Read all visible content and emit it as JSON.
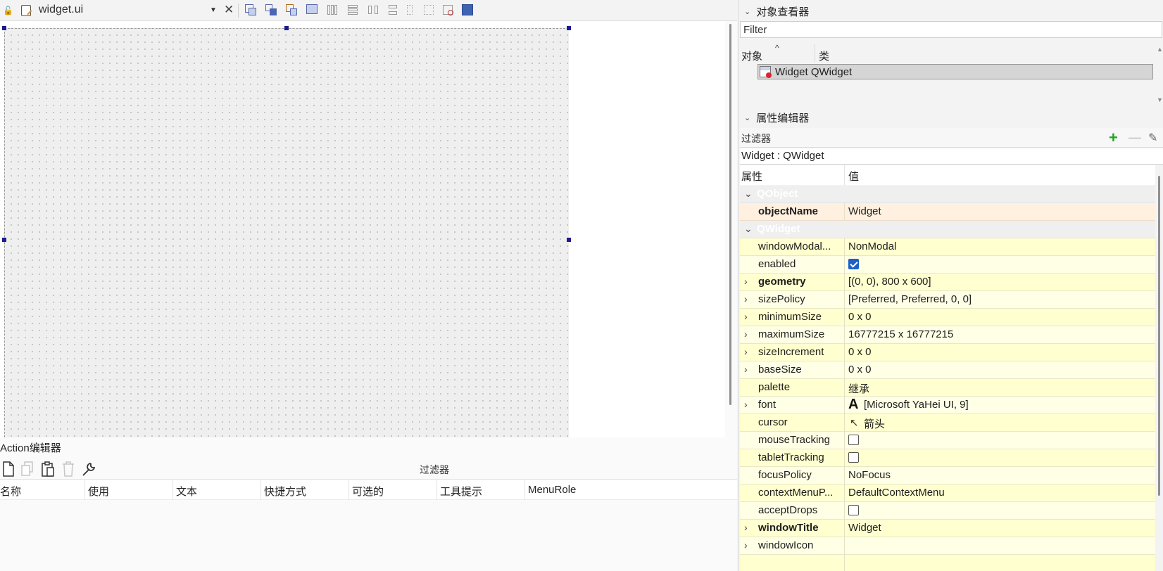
{
  "editor": {
    "filename": "widget.ui"
  },
  "action_editor": {
    "title": "Action编辑器",
    "filter_label": "过滤器",
    "columns": [
      "名称",
      "使用",
      "文本",
      "快捷方式",
      "可选的",
      "工具提示",
      "MenuRole"
    ]
  },
  "object_inspector": {
    "title": "对象查看器",
    "filter_placeholder": "Filter",
    "col_object": "对象",
    "col_class": "类",
    "sort_indicator": "^",
    "row": "Widget  QWidget"
  },
  "property_editor": {
    "title": "属性编辑器",
    "filter_label": "过滤器",
    "class_line": "Widget : QWidget",
    "col_property": "属性",
    "col_value": "值",
    "groups": {
      "qobject": "QObject",
      "qwidget": "QWidget"
    },
    "rows": {
      "objectName": {
        "name": "objectName",
        "value": "Widget"
      },
      "windowModality": {
        "name": "windowModal...",
        "value": "NonModal"
      },
      "enabled": {
        "name": "enabled",
        "checked": true
      },
      "geometry": {
        "name": "geometry",
        "value": "[(0, 0), 800 x 600]"
      },
      "sizePolicy": {
        "name": "sizePolicy",
        "value": "[Preferred, Preferred, 0, 0]"
      },
      "minimumSize": {
        "name": "minimumSize",
        "value": "0 x 0"
      },
      "maximumSize": {
        "name": "maximumSize",
        "value": "16777215 x 16777215"
      },
      "sizeIncrement": {
        "name": "sizeIncrement",
        "value": "0 x 0"
      },
      "baseSize": {
        "name": "baseSize",
        "value": "0 x 0"
      },
      "palette": {
        "name": "palette",
        "value": "继承"
      },
      "font": {
        "name": "font",
        "value": "[Microsoft YaHei UI, 9]",
        "icon": "A"
      },
      "cursor": {
        "name": "cursor",
        "value": "箭头"
      },
      "mouseTracking": {
        "name": "mouseTracking",
        "checked": false
      },
      "tabletTracking": {
        "name": "tabletTracking",
        "checked": false
      },
      "focusPolicy": {
        "name": "focusPolicy",
        "value": "NoFocus"
      },
      "contextMenuPolicy": {
        "name": "contextMenuP...",
        "value": "DefaultContextMenu"
      },
      "acceptDrops": {
        "name": "acceptDrops",
        "checked": false
      },
      "windowTitle": {
        "name": "windowTitle",
        "value": "Widget"
      },
      "windowIcon": {
        "name": "windowIcon",
        "value": ""
      }
    }
  },
  "colors": {
    "selection_handle": "#1b1b8f",
    "property_row_bg": "#ffffcf",
    "checkbox_checked": "#1d60c7",
    "add_icon": "#23a323"
  },
  "icons": [
    "lock-icon",
    "ui-file-icon",
    "dropdown-arrow-icon",
    "close-icon",
    "edit-widgets-icon",
    "edit-signals-icon",
    "edit-buddies-icon",
    "edit-tab-order-icon",
    "layout-horizontal-icon",
    "layout-vertical-icon",
    "layout-horizontal-splitter-icon",
    "layout-vertical-splitter-icon",
    "layout-form-icon",
    "layout-grid-icon",
    "break-layout-icon",
    "adjust-size-icon",
    "new-action-icon",
    "copy-action-icon",
    "paste-action-icon",
    "delete-action-icon",
    "configure-icon",
    "add-property-icon",
    "remove-property-icon",
    "wrench-icon"
  ]
}
